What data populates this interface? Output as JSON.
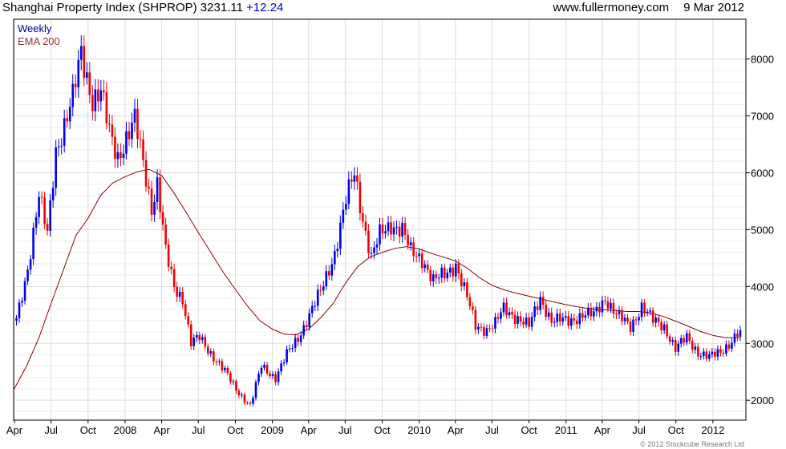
{
  "header": {
    "title": "Shanghai Property Index (SHPROP)",
    "last": "3231.11",
    "change": "+12.24",
    "site": "www.fullermoney.com",
    "date": "9 Mar 2012"
  },
  "copyright": "© 2012 Stockcube Research Ltd",
  "colors": {
    "up": "#0000ee",
    "down": "#ee0000",
    "ema": "#8b0000",
    "grid": "#dddddd",
    "frame": "#000000",
    "legend_weekly": "#000099",
    "legend_ema": "#993333"
  },
  "chart_data": {
    "type": "candlestick",
    "yaxis_side": "right",
    "ylim": [
      1650,
      8700
    ],
    "yticks": [
      2000,
      3000,
      4000,
      5000,
      6000,
      7000,
      8000
    ],
    "xlim": [
      "2007-03-30",
      "2012-03-23"
    ],
    "xticks": [
      {
        "label": "Apr",
        "date": "2007-04-01"
      },
      {
        "label": "Jul",
        "date": "2007-07-01"
      },
      {
        "label": "Oct",
        "date": "2007-10-01"
      },
      {
        "label": "2008",
        "date": "2008-01-01"
      },
      {
        "label": "Apr",
        "date": "2008-04-01"
      },
      {
        "label": "Jul",
        "date": "2008-07-01"
      },
      {
        "label": "Oct",
        "date": "2008-10-01"
      },
      {
        "label": "2009",
        "date": "2009-01-01"
      },
      {
        "label": "Apr",
        "date": "2009-04-01"
      },
      {
        "label": "Jul",
        "date": "2009-07-01"
      },
      {
        "label": "Oct",
        "date": "2009-10-01"
      },
      {
        "label": "2010",
        "date": "2010-01-01"
      },
      {
        "label": "Apr",
        "date": "2010-04-01"
      },
      {
        "label": "Jul",
        "date": "2010-07-01"
      },
      {
        "label": "Oct",
        "date": "2010-10-01"
      },
      {
        "label": "2011",
        "date": "2011-01-01"
      },
      {
        "label": "Apr",
        "date": "2011-04-01"
      },
      {
        "label": "Jul",
        "date": "2011-07-01"
      },
      {
        "label": "Oct",
        "date": "2011-10-01"
      },
      {
        "label": "2012",
        "date": "2012-01-01"
      }
    ],
    "legend": [
      {
        "label": "Weekly"
      },
      {
        "label": "EMA 200"
      }
    ],
    "series": [
      {
        "name": "Weekly",
        "kind": "candlestick",
        "anchor_closes": [
          [
            "2007-04-06",
            3400
          ],
          [
            "2007-05-01",
            4200
          ],
          [
            "2007-06-01",
            5600
          ],
          [
            "2007-06-22",
            4900
          ],
          [
            "2007-07-13",
            6400
          ],
          [
            "2007-08-24",
            7300
          ],
          [
            "2007-09-14",
            8100
          ],
          [
            "2007-10-12",
            7300
          ],
          [
            "2007-11-02",
            7400
          ],
          [
            "2007-11-23",
            6700
          ],
          [
            "2007-12-14",
            6300
          ],
          [
            "2008-01-04",
            6600
          ],
          [
            "2008-01-25",
            6900
          ],
          [
            "2008-02-15",
            6200
          ],
          [
            "2008-03-07",
            5400
          ],
          [
            "2008-03-21",
            5800
          ],
          [
            "2008-04-11",
            4600
          ],
          [
            "2008-05-02",
            4000
          ],
          [
            "2008-05-23",
            3800
          ],
          [
            "2008-06-13",
            3000
          ],
          [
            "2008-07-04",
            3100
          ],
          [
            "2008-07-25",
            2900
          ],
          [
            "2008-08-15",
            2700
          ],
          [
            "2008-09-05",
            2500
          ],
          [
            "2008-10-03",
            2200
          ],
          [
            "2008-11-07",
            1900
          ],
          [
            "2008-12-05",
            2600
          ],
          [
            "2009-01-09",
            2400
          ],
          [
            "2009-02-06",
            2800
          ],
          [
            "2009-03-06",
            3100
          ],
          [
            "2009-04-03",
            3500
          ],
          [
            "2009-05-01",
            3900
          ],
          [
            "2009-06-05",
            4600
          ],
          [
            "2009-07-03",
            5500
          ],
          [
            "2009-07-24",
            6000
          ],
          [
            "2009-08-14",
            5200
          ],
          [
            "2009-09-04",
            4500
          ],
          [
            "2009-09-25",
            4900
          ],
          [
            "2009-10-23",
            5100
          ],
          [
            "2009-11-20",
            5000
          ],
          [
            "2009-12-11",
            4600
          ],
          [
            "2010-01-08",
            4500
          ],
          [
            "2010-02-05",
            4100
          ],
          [
            "2010-03-05",
            4200
          ],
          [
            "2010-04-02",
            4400
          ],
          [
            "2010-04-30",
            3800
          ],
          [
            "2010-05-21",
            3300
          ],
          [
            "2010-06-18",
            3250
          ],
          [
            "2010-07-09",
            3350
          ],
          [
            "2010-07-30",
            3600
          ],
          [
            "2010-09-03",
            3450
          ],
          [
            "2010-10-01",
            3300
          ],
          [
            "2010-10-29",
            3800
          ],
          [
            "2010-11-26",
            3400
          ],
          [
            "2011-01-07",
            3400
          ],
          [
            "2011-02-11",
            3500
          ],
          [
            "2011-03-11",
            3500
          ],
          [
            "2011-04-08",
            3800
          ],
          [
            "2011-05-06",
            3500
          ],
          [
            "2011-06-10",
            3300
          ],
          [
            "2011-07-08",
            3650
          ],
          [
            "2011-08-05",
            3400
          ],
          [
            "2011-09-02",
            3300
          ],
          [
            "2011-09-30",
            2900
          ],
          [
            "2011-10-28",
            3100
          ],
          [
            "2011-11-25",
            2850
          ],
          [
            "2011-12-23",
            2750
          ],
          [
            "2012-01-20",
            2850
          ],
          [
            "2012-02-17",
            3050
          ],
          [
            "2012-03-09",
            3231
          ]
        ]
      },
      {
        "name": "EMA 200",
        "kind": "line",
        "points": [
          [
            "2007-03-30",
            2180
          ],
          [
            "2007-05-01",
            2600
          ],
          [
            "2007-06-01",
            3100
          ],
          [
            "2007-07-01",
            3700
          ],
          [
            "2007-08-01",
            4300
          ],
          [
            "2007-09-01",
            4900
          ],
          [
            "2007-10-01",
            5200
          ],
          [
            "2007-11-01",
            5600
          ],
          [
            "2007-12-01",
            5820
          ],
          [
            "2008-01-01",
            5930
          ],
          [
            "2008-02-01",
            6020
          ],
          [
            "2008-03-01",
            6060
          ],
          [
            "2008-04-01",
            5950
          ],
          [
            "2008-05-01",
            5650
          ],
          [
            "2008-06-01",
            5300
          ],
          [
            "2008-07-01",
            4950
          ],
          [
            "2008-08-01",
            4600
          ],
          [
            "2008-09-01",
            4250
          ],
          [
            "2008-10-01",
            3950
          ],
          [
            "2008-11-01",
            3650
          ],
          [
            "2008-12-01",
            3400
          ],
          [
            "2009-01-01",
            3250
          ],
          [
            "2009-02-01",
            3160
          ],
          [
            "2009-03-01",
            3150
          ],
          [
            "2009-04-01",
            3250
          ],
          [
            "2009-05-01",
            3450
          ],
          [
            "2009-06-01",
            3700
          ],
          [
            "2009-07-01",
            4050
          ],
          [
            "2009-08-01",
            4350
          ],
          [
            "2009-09-01",
            4520
          ],
          [
            "2009-10-01",
            4600
          ],
          [
            "2009-11-01",
            4670
          ],
          [
            "2009-12-01",
            4700
          ],
          [
            "2010-01-01",
            4660
          ],
          [
            "2010-02-01",
            4580
          ],
          [
            "2010-03-01",
            4520
          ],
          [
            "2010-04-01",
            4450
          ],
          [
            "2010-05-01",
            4320
          ],
          [
            "2010-06-01",
            4150
          ],
          [
            "2010-07-01",
            4020
          ],
          [
            "2010-08-01",
            3940
          ],
          [
            "2010-09-01",
            3880
          ],
          [
            "2010-10-01",
            3830
          ],
          [
            "2010-11-01",
            3780
          ],
          [
            "2010-12-01",
            3730
          ],
          [
            "2011-01-01",
            3680
          ],
          [
            "2011-02-01",
            3640
          ],
          [
            "2011-03-01",
            3610
          ],
          [
            "2011-04-01",
            3590
          ],
          [
            "2011-05-01",
            3580
          ],
          [
            "2011-06-01",
            3560
          ],
          [
            "2011-07-01",
            3560
          ],
          [
            "2011-08-01",
            3530
          ],
          [
            "2011-09-01",
            3470
          ],
          [
            "2011-10-01",
            3390
          ],
          [
            "2011-11-01",
            3300
          ],
          [
            "2011-12-01",
            3210
          ],
          [
            "2012-01-01",
            3140
          ],
          [
            "2012-02-01",
            3100
          ],
          [
            "2012-03-09",
            3100
          ]
        ]
      }
    ]
  }
}
